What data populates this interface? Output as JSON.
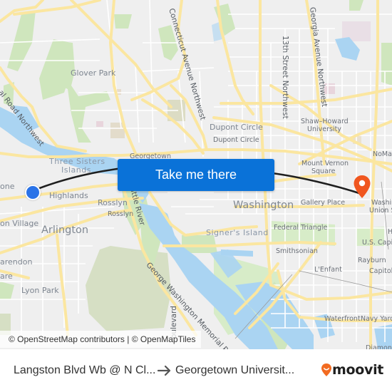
{
  "map": {
    "labels": {
      "glover_park": "Glover Park",
      "dupont_circle_area": "Dupont Circle",
      "dupont_circle_station": "Dupont Circle",
      "shaw_howard": "Shaw–Howard",
      "shaw_howard_2": "University",
      "noma": "NoMa-",
      "mount_vernon": "Mount Vernon",
      "mount_vernon_2": "Square",
      "georgetown": "Georgetown",
      "three_sisters": "Three Sisters",
      "three_sisters_2": "Islands",
      "highlands": "Highlands",
      "rosslyn_area": "Rosslyn",
      "rosslyn_station": "Rosslyn",
      "arlington": "Arlington",
      "court_house_village": "on Village",
      "one": "one",
      "clarendon": "arendon",
      "square_frag": "are",
      "lyon_park": "Lyon Park",
      "washington": "Washington",
      "gallery_place": "Gallery Place",
      "union_station": "Washin",
      "union_station_2": "Union S",
      "signers_island": "Signer's Island",
      "federal_triangle": "Federal Triangle",
      "capitol": "U.S. Capito",
      "smithsonian": "Smithsonian",
      "raybum": "Rayburn",
      "capitol_south": "Capitol S",
      "lenfant": "L'Enfant",
      "waterfront": "Waterfront",
      "navy_yard": "Navy Yard-",
      "diamond": "Diamond",
      "h_frag": "H"
    },
    "roads": {
      "connecticut": "Connecticut Avenue Northwest",
      "georgia": "Georgia Avenue Northwest",
      "thirteenth": "13th Street Northwest",
      "canal_road": "al Road Northwest",
      "little_river": "Little River",
      "gw_parkway": "George Washington Memorial Parkway",
      "boulevard": "oulevard"
    },
    "attribution": "© OpenStreetMap contributors | © OpenMapTiles",
    "cta_label": "Take me there",
    "colors": {
      "route": "#1f1f1f",
      "origin": "#2a73e8",
      "destination": "#f0561f",
      "cta": "#0a72d8",
      "water": "#aad3f2",
      "park": "#cde8b8",
      "road": "#fbe7a3"
    }
  },
  "footer": {
    "from": "Langston Blvd Wb @ N Cl...",
    "arrow_icon": "right-arrow",
    "to": "Georgetown Universit...",
    "brand": "moovit",
    "brand_color": "#f26b21"
  }
}
